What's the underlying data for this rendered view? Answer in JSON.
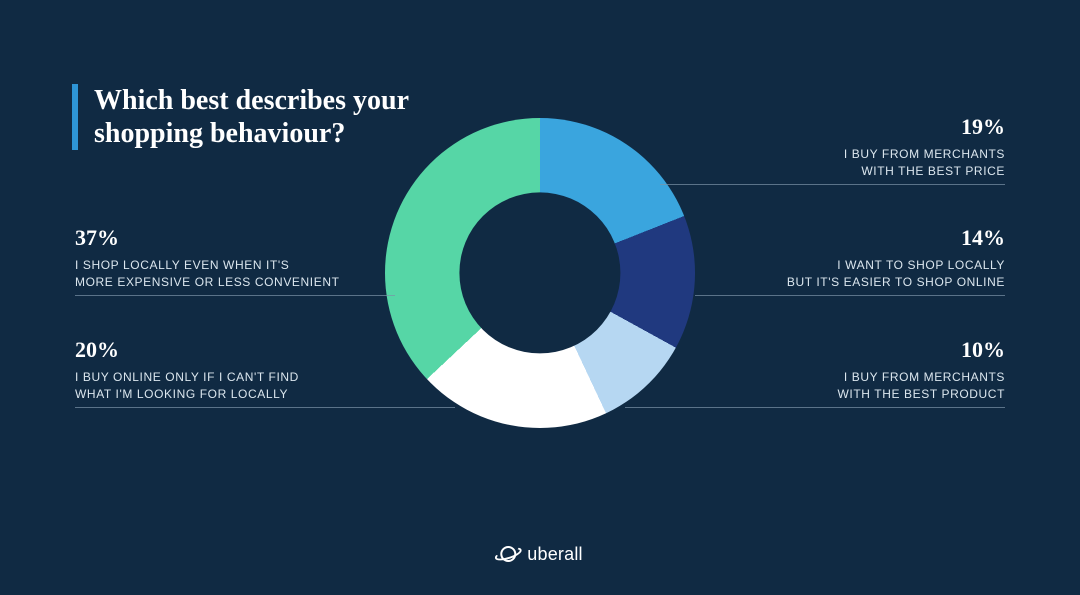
{
  "title_line1": "Which best describes your",
  "title_line2": "shopping behaviour?",
  "brand": "uberall",
  "segments": {
    "best_price": {
      "percent": "19%",
      "desc_l1": "I BUY FROM MERCHANTS",
      "desc_l2": "WITH THE BEST PRICE"
    },
    "easier_online": {
      "percent": "14%",
      "desc_l1": "I WANT TO SHOP LOCALLY",
      "desc_l2": "BUT IT'S EASIER TO SHOP ONLINE"
    },
    "best_product": {
      "percent": "10%",
      "desc_l1": "I BUY FROM MERCHANTS",
      "desc_l2": "WITH THE BEST PRODUCT"
    },
    "online_only": {
      "percent": "20%",
      "desc_l1": "I BUY ONLINE ONLY IF I CAN'T FIND",
      "desc_l2": "WHAT I'M LOOKING FOR LOCALLY"
    },
    "shop_local": {
      "percent": "37%",
      "desc_l1": "I SHOP LOCALLY EVEN WHEN IT'S",
      "desc_l2": "MORE EXPENSIVE OR LESS CONVENIENT"
    }
  },
  "chart_data": {
    "type": "pie",
    "title": "Which best describes your shopping behaviour?",
    "categories": [
      "I buy from merchants with the best price",
      "I want to shop locally but it's easier to shop online",
      "I buy from merchants with the best product",
      "I buy online only if I can't find what I'm looking for locally",
      "I shop locally even when it's more expensive or less convenient"
    ],
    "values": [
      19,
      14,
      10,
      20,
      37
    ],
    "colors": [
      "#3aa5de",
      "#20397f",
      "#b6d7f2",
      "#ffffff",
      "#56d6a6"
    ],
    "donut": true
  }
}
